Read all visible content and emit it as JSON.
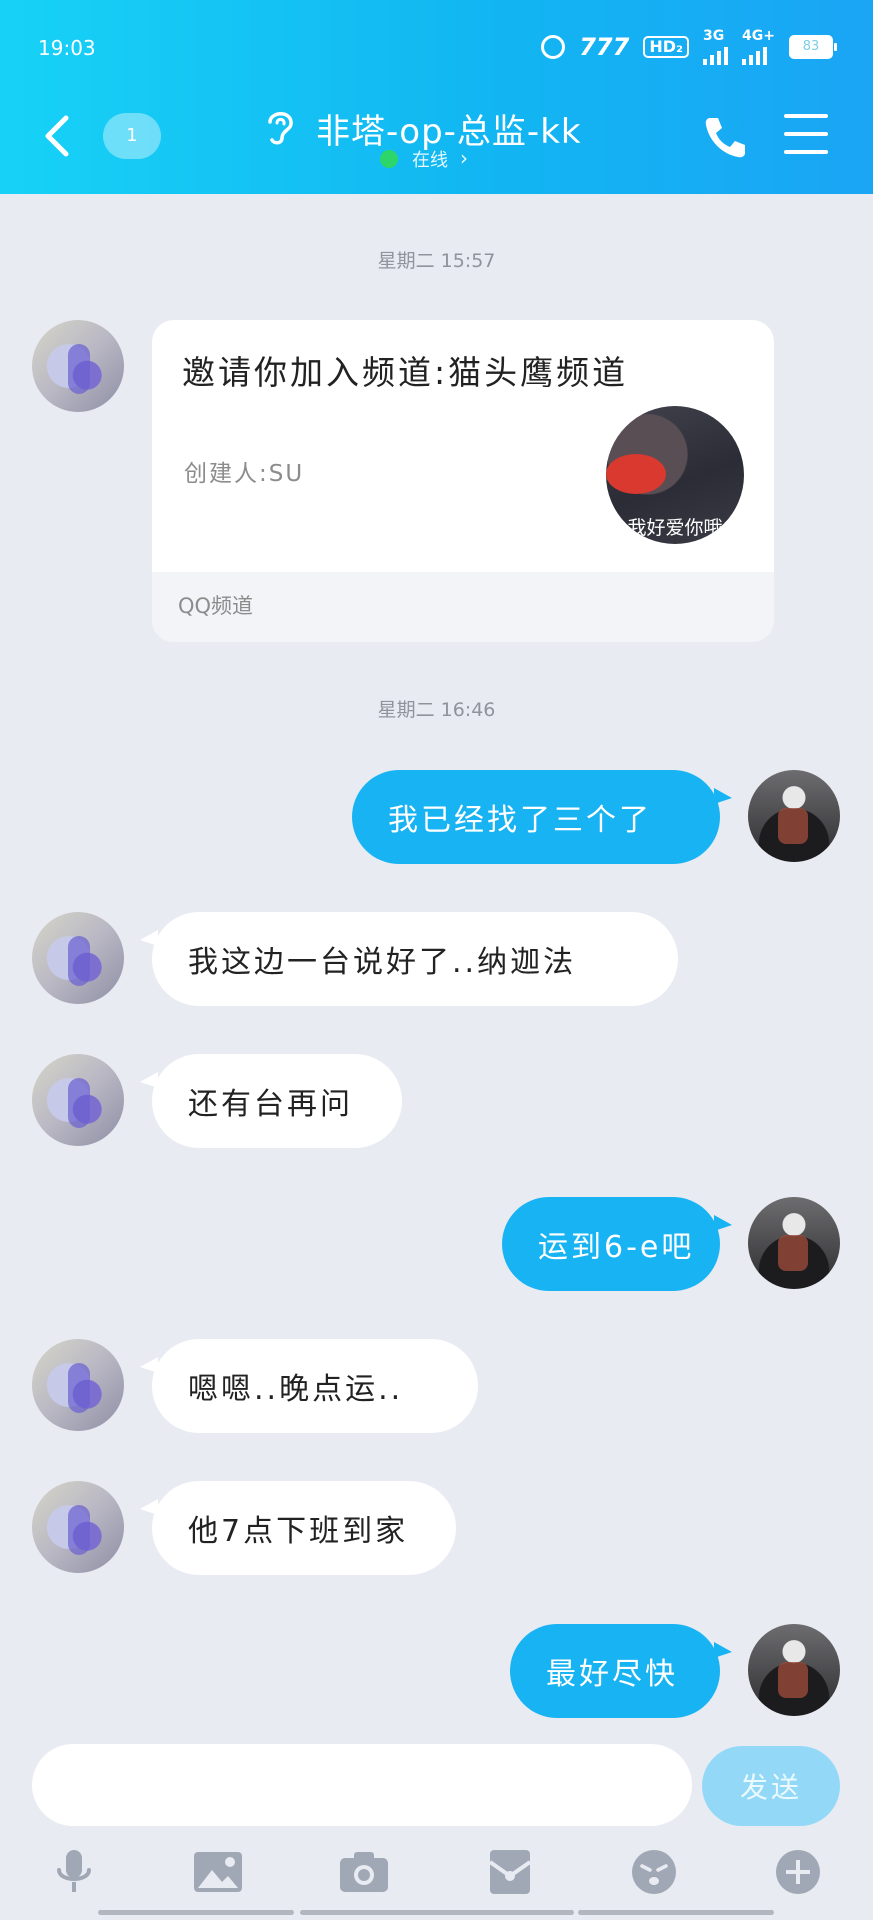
{
  "status_bar": {
    "time": "19:03",
    "carrier_mark": "777",
    "hd": "HD₂",
    "net1": "3G",
    "net2": "4G+",
    "battery": "83"
  },
  "header": {
    "unread_count": "1",
    "chat_title": "非塔-op-总监-kk",
    "status_text": "在线",
    "chevron": "›"
  },
  "timestamps": [
    "星期二 15:57",
    "星期二 16:46"
  ],
  "card": {
    "title": "邀请你加入频道:猫头鹰频道",
    "creator": "创建人:SU",
    "avatar_caption": "我好爱你哦",
    "source": "QQ频道"
  },
  "messages": [
    {
      "from": "me",
      "text": "我已经找了三个了"
    },
    {
      "from": "friend",
      "text": "我这边一台说好了..纳迦法"
    },
    {
      "from": "friend",
      "text": "还有台再问"
    },
    {
      "from": "me",
      "text": "运到6-e吧"
    },
    {
      "from": "friend",
      "text": "嗯嗯..晚点运.."
    },
    {
      "from": "friend",
      "text": "他7点下班到家"
    },
    {
      "from": "me",
      "text": "最好尽快"
    }
  ],
  "input": {
    "placeholder": "",
    "send_label": "发送"
  },
  "toolbar_icons": [
    "microphone-icon",
    "image-icon",
    "camera-icon",
    "red-packet-icon",
    "emoji-icon",
    "plus-icon"
  ],
  "colors": {
    "header_start": "#17d2f6",
    "header_end": "#1aa5f5",
    "outgoing_bubble": "#18b3f2",
    "send_button": "#93d9f7",
    "online": "#2cd66a",
    "background": "#e9ebf2"
  }
}
